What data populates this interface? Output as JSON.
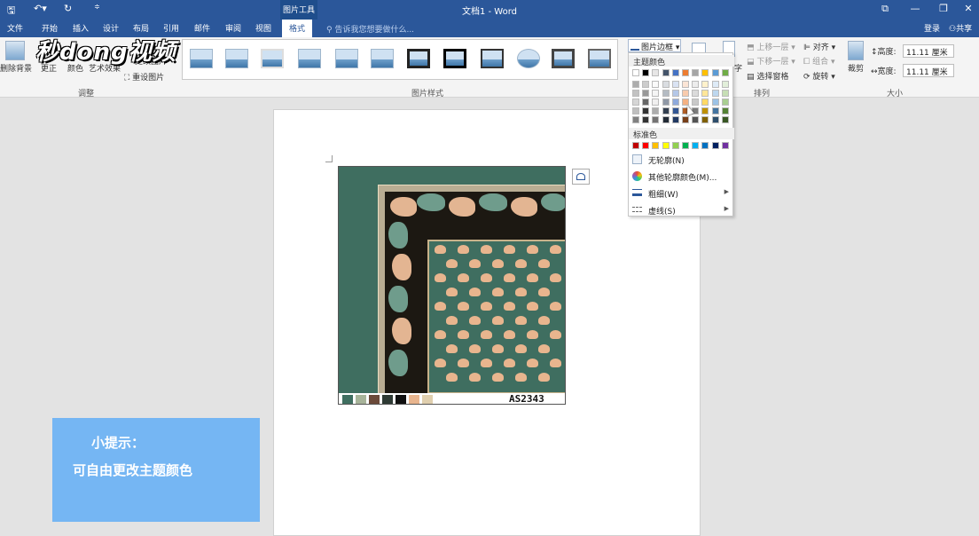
{
  "titlebar": {
    "title": "文档1 - Word",
    "tool_tab": "图片工具",
    "save_icon": "save-icon",
    "undo_icon": "undo-icon",
    "redo_icon": "redo-icon",
    "customize_icon": "customize-toolbar-icon",
    "ribbon_options_glyph": "⧉",
    "minimize_glyph": "—",
    "restore_glyph": "❐",
    "close_glyph": "✕"
  },
  "tabs": [
    "文件",
    "开始",
    "插入",
    "设计",
    "布局",
    "引用",
    "邮件",
    "审阅",
    "视图",
    "格式"
  ],
  "tell_me": "告诉我您想要做什么...",
  "account": {
    "login": "登录",
    "share": "共享"
  },
  "ribbon": {
    "remove_bg": "删除背景",
    "corrections": "更正",
    "color": "颜色",
    "artistic": "艺术效果",
    "change_picture": "更改图片",
    "reset_picture": "重设图片",
    "adjust_label": "调整",
    "picture_styles_label": "图片样式",
    "picture_border": "图片边框",
    "wrap_text": "字",
    "bring_forward": "上移一层",
    "send_backward": "下移一层",
    "selection_pane": "选择窗格",
    "align": "对齐",
    "group": "组合",
    "rotate": "旋转",
    "arrange_label": "排列",
    "crop": "裁剪",
    "height_label": "高度:",
    "height_value": "11.11 厘米",
    "width_label": "宽度:",
    "width_value": "11.11 厘米",
    "size_label": "大小"
  },
  "watermark": "秒dong视频",
  "dropdown": {
    "theme_colors_label": "主题颜色",
    "standard_colors_label": "标准色",
    "no_outline": "无轮廓(N)",
    "more_colors": "其他轮廓颜色(M)...",
    "weight": "粗细(W)",
    "dashes": "虚线(S)",
    "theme_top": [
      "#ffffff",
      "#000000",
      "#e7e6e6",
      "#44546a",
      "#4472c4",
      "#ed7d31",
      "#a5a5a5",
      "#ffc000",
      "#5b9bd5",
      "#70ad47"
    ],
    "standard": [
      "#c00000",
      "#ff0000",
      "#ffc000",
      "#ffff00",
      "#92d050",
      "#00b050",
      "#00b0f0",
      "#0070c0",
      "#002060",
      "#7030a0"
    ]
  },
  "image": {
    "code": "AS2343",
    "swatches": [
      "#3f6e60",
      "#a8b49a",
      "#6b4a3a",
      "#2e3a34",
      "#101010",
      "#e8b58e",
      "#e0cfae"
    ]
  },
  "tip": {
    "line1": "小提示：",
    "line2": "可自由更改主题颜色"
  }
}
